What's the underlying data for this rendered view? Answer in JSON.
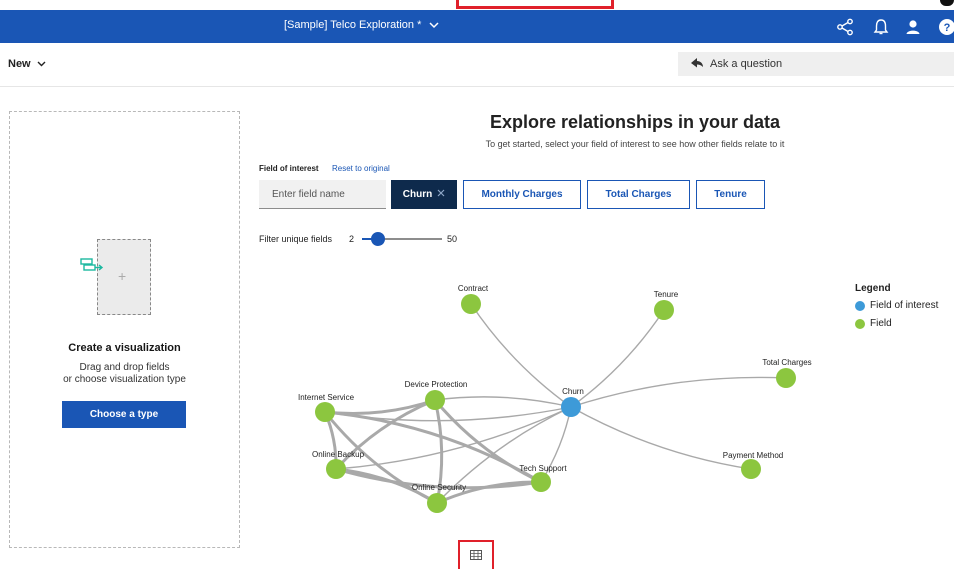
{
  "header": {
    "title": "[Sample] Telco Exploration *",
    "icons": [
      "share-icon",
      "notification-bell-icon",
      "user-icon",
      "help-icon"
    ],
    "help_glyph": "?"
  },
  "toolbar": {
    "new_label": "New",
    "ask_label": "Ask a question"
  },
  "left_panel": {
    "title": "Create a visualization",
    "subtitle_line1": "Drag and drop fields",
    "subtitle_line2": "or choose visualization type",
    "choose_button": "Choose a type",
    "plus_glyph": "+"
  },
  "explore": {
    "title": "Explore relationships in your data",
    "subtitle": "To get started, select your field of interest to see how other fields relate to it",
    "field_of_interest_label": "Field of interest",
    "reset_label": "Reset to original",
    "field_input_placeholder": "Enter field name",
    "selected_field": "Churn",
    "suggested_fields": [
      "Monthly Charges",
      "Total Charges",
      "Tenure"
    ],
    "filter_label": "Filter unique fields",
    "filter_min": "2",
    "filter_max": "50",
    "filter_value_fraction": 0.2
  },
  "graph": {
    "nodes": [
      {
        "id": "contract",
        "label": "Contract",
        "kind": "field"
      },
      {
        "id": "tenure",
        "label": "Tenure",
        "kind": "field"
      },
      {
        "id": "churn",
        "label": "Churn",
        "kind": "interest"
      },
      {
        "id": "total_charges",
        "label": "Total Charges",
        "kind": "field"
      },
      {
        "id": "payment_method",
        "label": "Payment Method",
        "kind": "field"
      },
      {
        "id": "internet_service",
        "label": "Internet Service",
        "kind": "field"
      },
      {
        "id": "device_protection",
        "label": "Device Protection",
        "kind": "field"
      },
      {
        "id": "online_backup",
        "label": "Online Backup",
        "kind": "field"
      },
      {
        "id": "online_security",
        "label": "Online Security",
        "kind": "field"
      },
      {
        "id": "tech_support",
        "label": "Tech Support",
        "kind": "field"
      }
    ],
    "edges": [
      [
        "churn",
        "contract"
      ],
      [
        "churn",
        "tenure"
      ],
      [
        "churn",
        "total_charges"
      ],
      [
        "churn",
        "payment_method"
      ],
      [
        "churn",
        "internet_service"
      ],
      [
        "churn",
        "device_protection"
      ],
      [
        "churn",
        "online_backup"
      ],
      [
        "churn",
        "online_security"
      ],
      [
        "churn",
        "tech_support"
      ],
      [
        "internet_service",
        "device_protection"
      ],
      [
        "internet_service",
        "online_backup"
      ],
      [
        "internet_service",
        "online_security"
      ],
      [
        "internet_service",
        "tech_support"
      ],
      [
        "device_protection",
        "online_backup"
      ],
      [
        "device_protection",
        "online_security"
      ],
      [
        "device_protection",
        "tech_support"
      ],
      [
        "online_backup",
        "online_security"
      ],
      [
        "online_backup",
        "tech_support"
      ],
      [
        "online_security",
        "tech_support"
      ]
    ]
  },
  "legend": {
    "title": "Legend",
    "items": [
      {
        "label": "Field of interest",
        "color": "#3d9ad8"
      },
      {
        "label": "Field",
        "color": "#8cc63f"
      }
    ]
  },
  "colors": {
    "brand_blue": "#1a56b5",
    "selected_chip": "#0e2a4c",
    "interest_node": "#3d9ad8",
    "field_node": "#8cc63f",
    "highlight_red": "#e0202a"
  },
  "bottom": {
    "table_button_icon": "table-icon"
  }
}
